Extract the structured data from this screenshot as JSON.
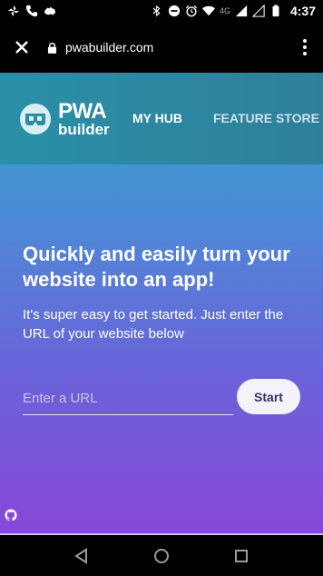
{
  "status_bar": {
    "network": "4G",
    "time": "4:37",
    "icons": [
      "pinwheel-icon",
      "phone-icon",
      "australia-map-icon",
      "bluetooth-icon",
      "do-not-disturb-icon",
      "alarm-icon",
      "wifi-icon",
      "signal-icon",
      "battery-icon"
    ]
  },
  "browser": {
    "url": "pwabuilder.com"
  },
  "site": {
    "logo_line1": "PWA",
    "logo_line2": "builder",
    "nav": {
      "my_hub": "MY HUB",
      "feature_store": "FEATURE STORE"
    }
  },
  "hero": {
    "title": "Quickly and easily turn your website into an app!",
    "subtitle": "It's super easy to get started. Just enter the URL of your website below",
    "input_placeholder": "Enter a URL",
    "input_value": "",
    "start_label": "Start"
  },
  "colors": {
    "header": "#2f8aa3",
    "gradient_top": "#2fa6c9",
    "gradient_bottom": "#8747d8",
    "button_bg": "#f4f2fb"
  }
}
